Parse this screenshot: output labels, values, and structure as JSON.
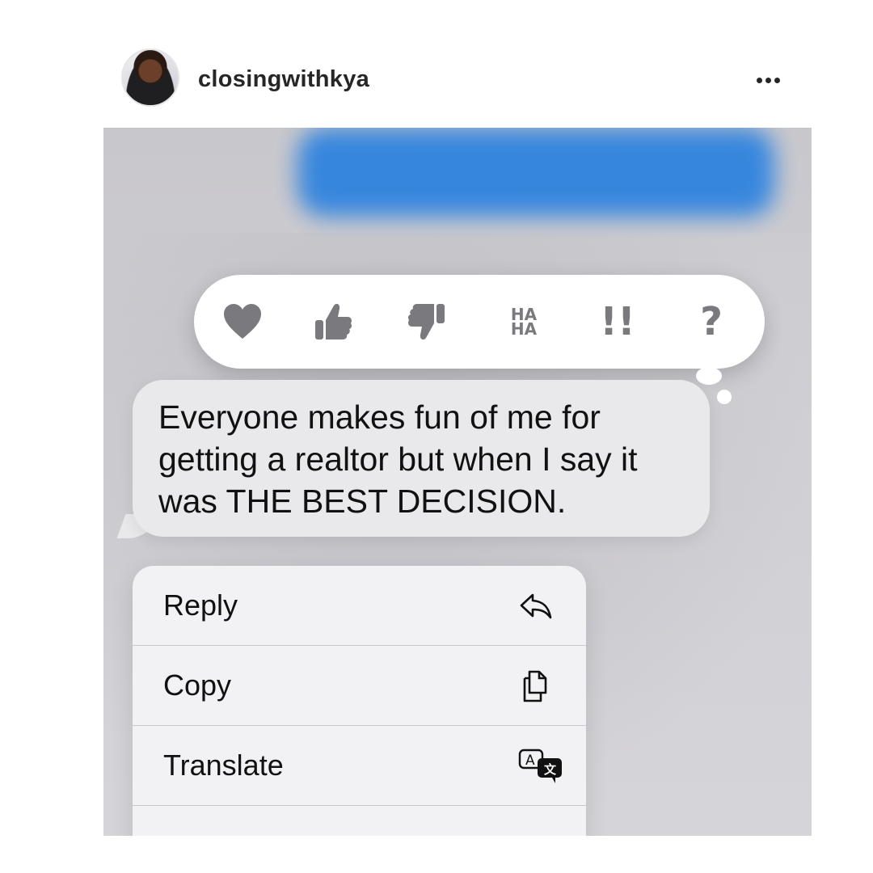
{
  "post": {
    "username": "closingwithkya",
    "more_icon": "more-horizontal-icon"
  },
  "tapbacks": [
    {
      "name": "heart",
      "icon": "heart-icon"
    },
    {
      "name": "thumbs-up",
      "icon": "thumbs-up-icon"
    },
    {
      "name": "thumbs-down",
      "icon": "thumbs-down-icon"
    },
    {
      "name": "haha",
      "icon": "haha-icon",
      "text_top": "HA",
      "text_bottom": "HA"
    },
    {
      "name": "emphasize",
      "icon": "double-exclamation-icon",
      "text": "!!"
    },
    {
      "name": "question",
      "icon": "question-icon",
      "text": "?"
    }
  ],
  "message": {
    "text": "Everyone makes fun of me for getting a realtor but when I say it was THE BEST DECISION."
  },
  "menu": {
    "items": [
      {
        "label": "Reply",
        "icon": "reply-icon"
      },
      {
        "label": "Copy",
        "icon": "copy-icon"
      },
      {
        "label": "Translate",
        "icon": "translate-icon"
      }
    ]
  },
  "colors": {
    "sent_bubble": "#2f83df",
    "received_bubble": "#e9e9eb",
    "tapback_icon": "#7a7a7e",
    "background": "#cfced3"
  }
}
